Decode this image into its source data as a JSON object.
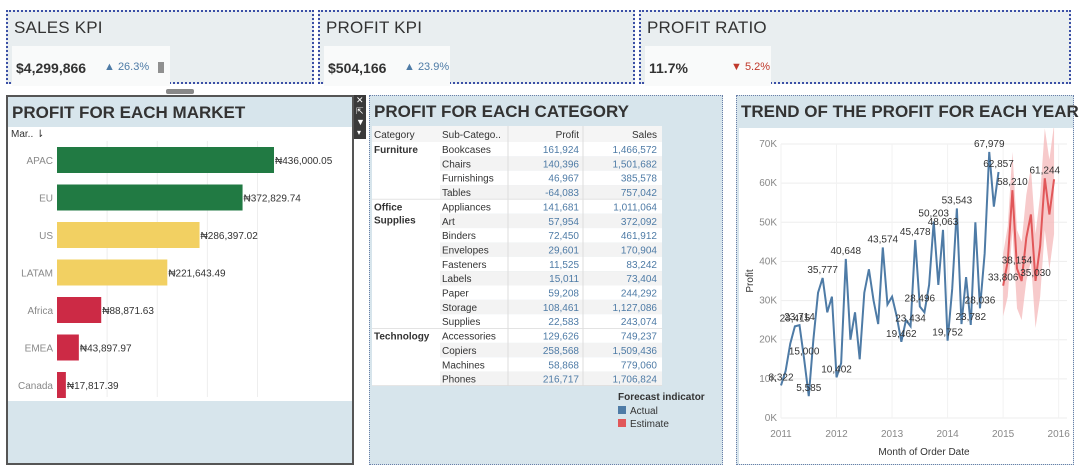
{
  "kpis": {
    "sales": {
      "title": "SALES KPI",
      "value": "$4,299,866",
      "delta": "▲ 26.3%"
    },
    "profit": {
      "title": "PROFIT KPI",
      "value": "$504,166",
      "delta": "▲ 23.9%"
    },
    "ratio": {
      "title": "PROFIT RATIO",
      "value": "11.7%",
      "delta": "▼ 5.2%"
    }
  },
  "colors": {
    "green": "#217a43",
    "yellow": "#f2d062",
    "red": "#cc2a45",
    "actual": "#4e7ba6",
    "estimate": "#e15759",
    "up": "#4e7ba6",
    "down": "#c0392b"
  },
  "chart_data": [
    {
      "type": "bar",
      "title": "PROFIT FOR EACH MARKET",
      "header": "Mar.. ⇂",
      "categories": [
        "APAC",
        "EU",
        "US",
        "LATAM",
        "Africa",
        "EMEA",
        "Canada"
      ],
      "values": [
        436000.05,
        372829.74,
        286397.02,
        221643.49,
        88871.63,
        43897.97,
        17817.39
      ],
      "labels": [
        "₦436,000.05",
        "₦372,829.74",
        "₦286,397.02",
        "₦221,643.49",
        "₦88,871.63",
        "₦43,897.97",
        "₦17,817.39"
      ],
      "bar_colors": [
        "#217a43",
        "#217a43",
        "#f2d062",
        "#f2d062",
        "#cc2a45",
        "#cc2a45",
        "#cc2a45"
      ]
    },
    {
      "type": "table",
      "title": "PROFIT FOR EACH CATEGORY",
      "columns": [
        "Category",
        "Sub-Catego..",
        "Profit",
        "Sales"
      ],
      "groups": [
        {
          "category": "Furniture",
          "rows": [
            {
              "sub": "Bookcases",
              "profit": "161,924",
              "sales": "1,466,572",
              "profit_value": 161924,
              "sales_value": 1466572
            },
            {
              "sub": "Chairs",
              "profit": "140,396",
              "sales": "1,501,682",
              "profit_value": 140396,
              "sales_value": 1501682
            },
            {
              "sub": "Furnishings",
              "profit": "46,967",
              "sales": "385,578",
              "profit_value": 46967,
              "sales_value": 385578
            },
            {
              "sub": "Tables",
              "profit": "-64,083",
              "sales": "757,042",
              "profit_value": -64083,
              "sales_value": 757042
            }
          ]
        },
        {
          "category": "Office Supplies",
          "rows": [
            {
              "sub": "Appliances",
              "profit": "141,681",
              "sales": "1,011,064",
              "profit_value": 141681,
              "sales_value": 1011064
            },
            {
              "sub": "Art",
              "profit": "57,954",
              "sales": "372,092",
              "profit_value": 57954,
              "sales_value": 372092
            },
            {
              "sub": "Binders",
              "profit": "72,450",
              "sales": "461,912",
              "profit_value": 72450,
              "sales_value": 461912
            },
            {
              "sub": "Envelopes",
              "profit": "29,601",
              "sales": "170,904",
              "profit_value": 29601,
              "sales_value": 170904
            },
            {
              "sub": "Fasteners",
              "profit": "11,525",
              "sales": "83,242",
              "profit_value": 11525,
              "sales_value": 83242
            },
            {
              "sub": "Labels",
              "profit": "15,011",
              "sales": "73,404",
              "profit_value": 15011,
              "sales_value": 73404
            },
            {
              "sub": "Paper",
              "profit": "59,208",
              "sales": "244,292",
              "profit_value": 59208,
              "sales_value": 244292
            },
            {
              "sub": "Storage",
              "profit": "108,461",
              "sales": "1,127,086",
              "profit_value": 108461,
              "sales_value": 1127086
            },
            {
              "sub": "Supplies",
              "profit": "22,583",
              "sales": "243,074",
              "profit_value": 22583,
              "sales_value": 243074
            }
          ]
        },
        {
          "category": "Technology",
          "rows": [
            {
              "sub": "Accessories",
              "profit": "129,626",
              "sales": "749,237",
              "profit_value": 129626,
              "sales_value": 749237
            },
            {
              "sub": "Copiers",
              "profit": "258,568",
              "sales": "1,509,436",
              "profit_value": 258568,
              "sales_value": 1509436
            },
            {
              "sub": "Machines",
              "profit": "58,868",
              "sales": "779,060",
              "profit_value": 58868,
              "sales_value": 779060
            },
            {
              "sub": "Phones",
              "profit": "216,717",
              "sales": "1,706,824",
              "profit_value": 216717,
              "sales_value": 1706824
            }
          ]
        }
      ],
      "legend": {
        "title": "Forecast indicator",
        "items": [
          "Actual",
          "Estimate"
        ]
      }
    },
    {
      "type": "line",
      "title": "TREND OF THE PROFIT FOR EACH YEAR",
      "xlabel": "Month of Order Date",
      "ylabel": "Profit",
      "ylim": [
        0,
        70000
      ],
      "y_ticks": [
        "0K",
        "10K",
        "20K",
        "30K",
        "40K",
        "50K",
        "60K",
        "70K"
      ],
      "x_ticks": [
        "2011",
        "2012",
        "2013",
        "2014",
        "2015",
        "2016"
      ],
      "grid": true,
      "series": [
        {
          "name": "Actual",
          "x": [
            2011.0,
            2011.083,
            2011.167,
            2011.25,
            2011.333,
            2011.417,
            2011.5,
            2011.583,
            2011.667,
            2011.75,
            2011.833,
            2011.917,
            2012.0,
            2012.083,
            2012.167,
            2012.25,
            2012.333,
            2012.417,
            2012.5,
            2012.583,
            2012.667,
            2012.75,
            2012.833,
            2012.917,
            2013.0,
            2013.083,
            2013.167,
            2013.25,
            2013.333,
            2013.417,
            2013.5,
            2013.583,
            2013.667,
            2013.75,
            2013.833,
            2013.917,
            2014.0,
            2014.083,
            2014.167,
            2014.25,
            2014.333,
            2014.417,
            2014.5,
            2014.583,
            2014.667,
            2014.75,
            2014.833,
            2014.917
          ],
          "y": [
            8322,
            12000,
            19000,
            23415,
            23714,
            15000,
            5585,
            20000,
            32000,
            35777,
            27000,
            31000,
            10402,
            14000,
            40648,
            20000,
            27000,
            15000,
            32000,
            38000,
            30000,
            24000,
            43574,
            29000,
            31000,
            26000,
            19462,
            25000,
            23434,
            45478,
            28496,
            27000,
            34000,
            50203,
            34000,
            48063,
            19752,
            33000,
            53543,
            24000,
            36000,
            23782,
            50000,
            28036,
            42000,
            67979,
            54000,
            62857
          ],
          "point_labels": {
            "0": "8,322",
            "3": "23,415",
            "4": "23,714",
            "5": "15,000",
            "6": "5,585",
            "9": "35,777",
            "12": "10,402",
            "14": "40,648",
            "22": "43,574",
            "26": "19,462",
            "28": "23,434",
            "29": "45,478",
            "30": "28,496",
            "33": "50,203",
            "35": "48,063",
            "36": "19,752",
            "38": "53,543",
            "41": "23,782",
            "43": "28,036",
            "45": "67,979",
            "47": "62,857"
          }
        },
        {
          "name": "Estimate",
          "x": [
            2015.0,
            2015.083,
            2015.167,
            2015.25,
            2015.333,
            2015.417,
            2015.5,
            2015.583,
            2015.667,
            2015.75,
            2015.833,
            2015.917
          ],
          "y": [
            33806,
            40000,
            58210,
            38154,
            35000,
            46000,
            52000,
            35030,
            44000,
            61244,
            52000,
            61000
          ],
          "band_low": [
            26000,
            31000,
            48000,
            28000,
            25000,
            35000,
            40000,
            23000,
            31000,
            48000,
            38000,
            47000
          ],
          "band_high": [
            42000,
            49000,
            68000,
            48000,
            45000,
            57000,
            64000,
            47000,
            57000,
            74000,
            66000,
            75000
          ],
          "point_labels": {
            "0": "33,806",
            "2": "58,210",
            "3": "38,154",
            "7": "35,030",
            "9": "61,244"
          }
        }
      ]
    }
  ]
}
